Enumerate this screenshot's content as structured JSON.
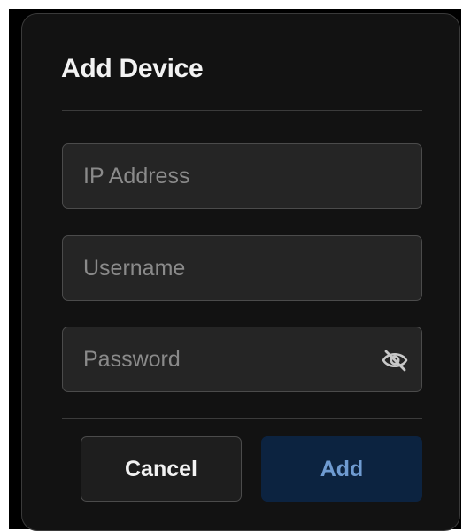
{
  "dialog": {
    "title": "Add Device"
  },
  "fields": {
    "ip_address": {
      "placeholder": "IP Address",
      "value": ""
    },
    "username": {
      "placeholder": "Username",
      "value": ""
    },
    "password": {
      "placeholder": "Password",
      "value": "",
      "toggle_icon": "eye-off-icon"
    }
  },
  "actions": {
    "cancel_label": "Cancel",
    "add_label": "Add"
  },
  "colors": {
    "dialog_background": "#121212",
    "field_background": "#252525",
    "add_button_background": "#0c2340",
    "add_button_text": "#6f9bd1"
  }
}
